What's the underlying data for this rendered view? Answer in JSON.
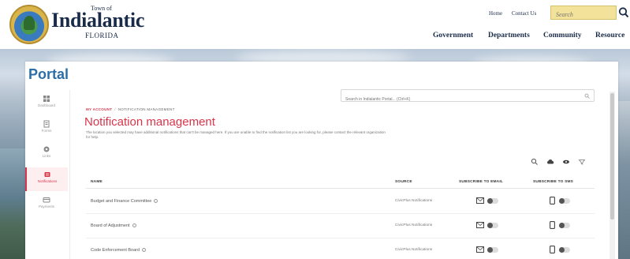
{
  "header": {
    "logo_small": "Town of",
    "logo_main": "Indialantic",
    "logo_sub": "FLORIDA",
    "utility_links": [
      "Home",
      "Contact Us"
    ],
    "search_placeholder": "Search",
    "nav": [
      "Government",
      "Departments",
      "Community",
      "Resource"
    ]
  },
  "portal": {
    "title": "Portal",
    "sidebar": [
      {
        "label": "Dashboard",
        "icon": "dashboard-icon"
      },
      {
        "label": "Forms",
        "icon": "forms-icon"
      },
      {
        "label": "Links",
        "icon": "links-icon"
      },
      {
        "label": "Notifications",
        "icon": "bell-icon",
        "active": true
      },
      {
        "label": "Payments",
        "icon": "payment-icon"
      }
    ],
    "search_placeholder": "Search in Indialantic Portal... (Ctrl+K)",
    "breadcrumb": {
      "parent": "MY ACCOUNT",
      "current": "NOTIFICATION MANAGEMENT"
    },
    "page_title": "Notification management",
    "description": "The location you selected may have additional notifications that can't be managed here. If you are unable to find the notification list you are looking for, please contact the relevant organization for help.",
    "tools": [
      "search-icon",
      "cloud-icon",
      "eye-icon",
      "filter-icon"
    ],
    "columns": {
      "name": "NAME",
      "source": "SOURCE",
      "email": "SUBSCRIBE TO EMAIL",
      "sms": "SUBSCRIBE TO SMS"
    },
    "rows": [
      {
        "name": "Budget and Finance Committee",
        "source": "CivicPlus Notifications"
      },
      {
        "name": "Board of Adjustment",
        "source": "CivicPlus Notifications"
      },
      {
        "name": "Code Enforcement Board",
        "source": "CivicPlus Notifications"
      }
    ]
  },
  "colors": {
    "accent": "#d9354a",
    "portal_blue": "#2b6ea8",
    "navy": "#1a2b4a",
    "search_yellow": "#f3e29a"
  }
}
